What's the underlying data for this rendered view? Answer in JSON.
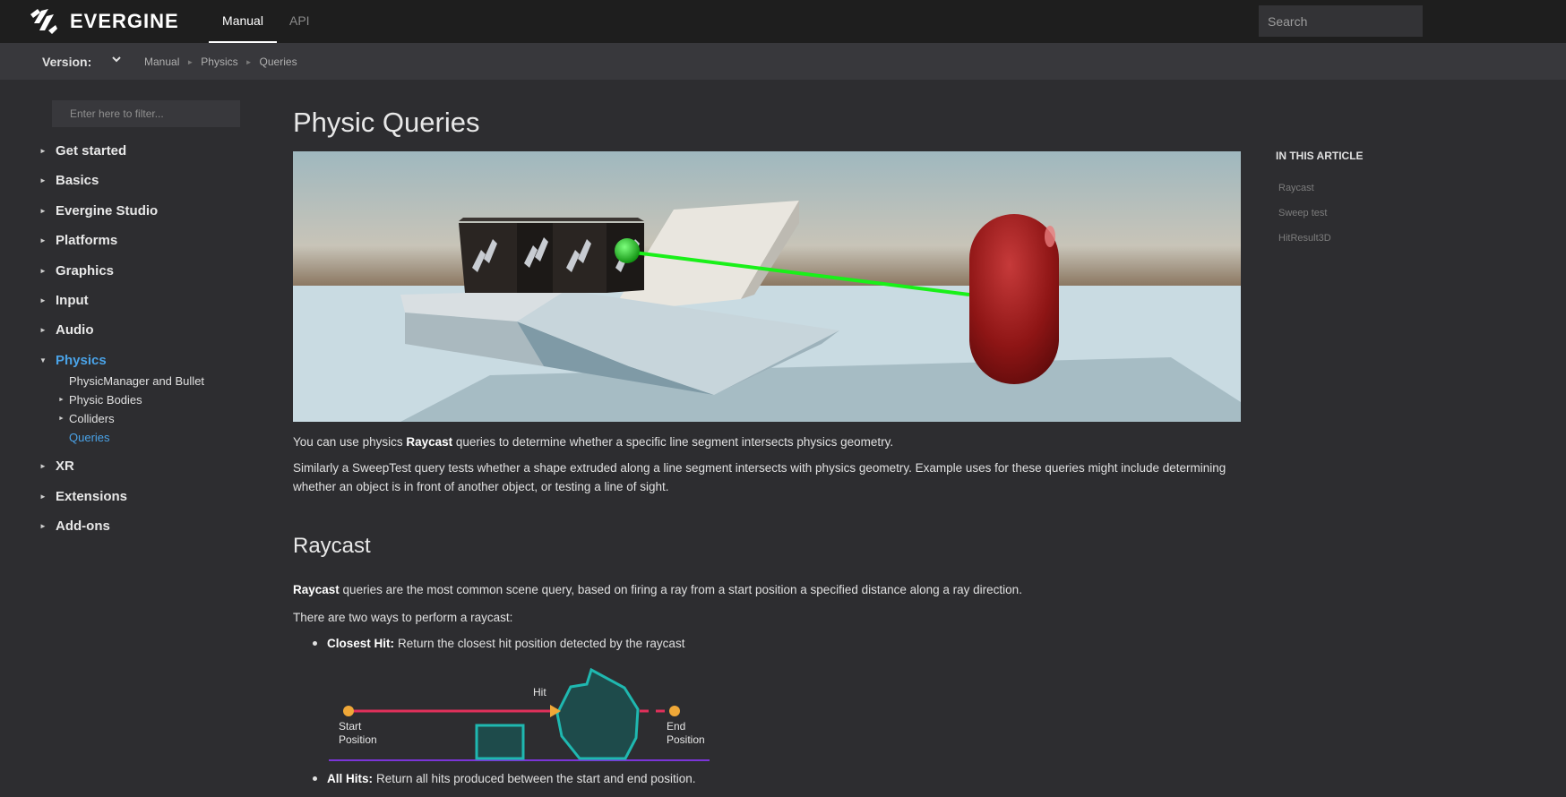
{
  "topbar": {
    "brand": "EVERGINE",
    "tabs": [
      {
        "label": "Manual",
        "active": true
      },
      {
        "label": "API",
        "active": false
      }
    ],
    "search_placeholder": "Search"
  },
  "subbar": {
    "version_label": "Version:",
    "breadcrumbs": [
      "Manual",
      "Physics",
      "Queries"
    ]
  },
  "sidebar": {
    "filter_placeholder": "Enter here to filter...",
    "items": [
      {
        "label": "Get started"
      },
      {
        "label": "Basics"
      },
      {
        "label": "Evergine Studio"
      },
      {
        "label": "Platforms"
      },
      {
        "label": "Graphics"
      },
      {
        "label": "Input"
      },
      {
        "label": "Audio"
      },
      {
        "label": "Physics",
        "expanded": true
      },
      {
        "label": "XR"
      },
      {
        "label": "Extensions"
      },
      {
        "label": "Add-ons"
      }
    ],
    "physics_children": [
      {
        "label": "PhysicManager and Bullet",
        "has_arrow": false
      },
      {
        "label": "Physic Bodies",
        "has_arrow": true
      },
      {
        "label": "Colliders",
        "has_arrow": true
      },
      {
        "label": "Queries",
        "has_arrow": false,
        "active": true
      }
    ]
  },
  "main": {
    "title": "Physic Queries",
    "intro_pre": "You can use physics ",
    "intro_bold": "Raycast",
    "intro_post": " queries to determine whether a specific line segment intersects physics geometry.",
    "sweep_para": "Similarly a SweepTest query tests whether a shape extruded along a line segment intersects with physics geometry. Example uses for these queries might include determining whether an object is in front of another object, or testing a line of sight.",
    "raycast_heading": "Raycast",
    "raycast_bold": "Raycast",
    "raycast_post": " queries are the most common scene query, based on firing a ray from a start position a specified distance along a ray direction.",
    "two_ways": "There are two ways to perform a raycast:",
    "bullets": [
      {
        "bold": "Closest Hit:",
        "text": "Return the closest hit position detected by the raycast"
      },
      {
        "bold": "All Hits:",
        "text": "Return all hits produced between the start and end position."
      }
    ],
    "diagram": {
      "hit_label": "Hit",
      "start_line1": "Start",
      "start_line2": "Position",
      "end_line1": "End",
      "end_line2": "Position"
    }
  },
  "article_nav": {
    "title": "IN THIS ARTICLE",
    "links": [
      "Raycast",
      "Sweep test",
      "HitResult3D"
    ]
  },
  "colors": {
    "accent": "#4aa3e8",
    "ray": "#e0305a",
    "shape": "#1fb8b0",
    "ground": "#7b35d8",
    "point": "#f0a838"
  }
}
